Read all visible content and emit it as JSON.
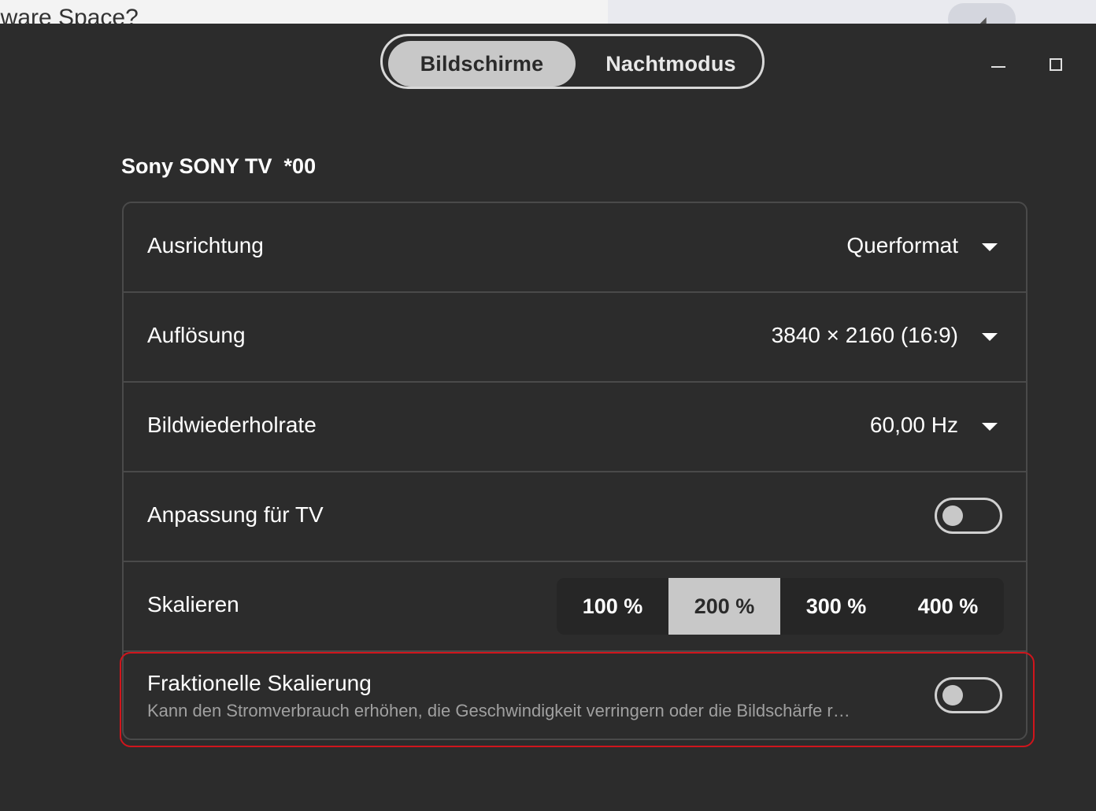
{
  "background_window": {
    "text": "lware Space?",
    "bubble_icon": "arrow-icon"
  },
  "header": {
    "tabs": [
      {
        "label": "Bildschirme",
        "active": true
      },
      {
        "label": "Nachtmodus",
        "active": false
      }
    ],
    "window_controls": {
      "minimize_icon": "minimize-icon",
      "maximize_icon": "maximize-icon"
    }
  },
  "monitor": {
    "title": "Sony SONY TV  *00"
  },
  "settings": {
    "orientation": {
      "label": "Ausrichtung",
      "value": "Querformat"
    },
    "resolution": {
      "label": "Auflösung",
      "value": "3840 × 2160 (16:9)"
    },
    "refresh_rate": {
      "label": "Bildwiederholrate",
      "value": "60,00 Hz"
    },
    "underscanning": {
      "label": "Anpassung für TV",
      "enabled": false
    },
    "scale": {
      "label": "Skalieren",
      "options": [
        "100 %",
        "200 %",
        "300 %",
        "400 %"
      ],
      "selected": "200 %"
    },
    "fractional_scaling": {
      "label": "Fraktionelle Skalierung",
      "description": "Kann den Stromverbrauch erhöhen, die Geschwindigkeit verringern oder die Bildschärfe r…",
      "enabled": false
    }
  },
  "colors": {
    "background": "#2c2c2c",
    "selected": "#c8c8c8",
    "highlight_border": "#d0151c",
    "row_border": "#4a4a4a"
  }
}
